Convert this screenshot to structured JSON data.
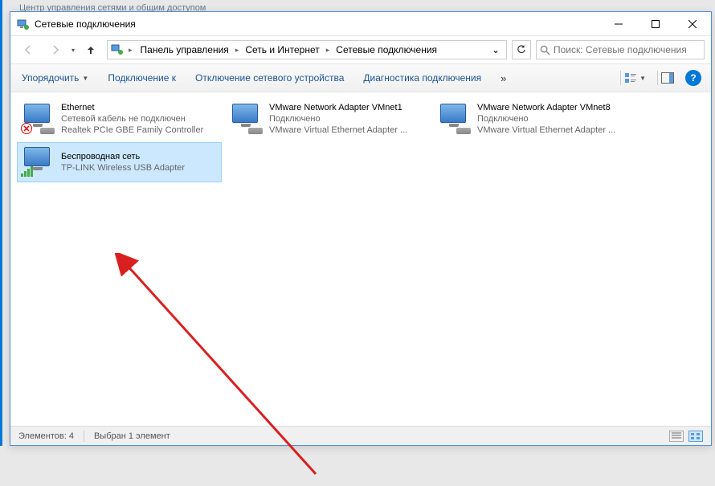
{
  "backgroundWindow": {
    "title": "Центр управления сетями и общим доступом"
  },
  "window": {
    "title": "Сетевые подключения"
  },
  "breadcrumb": {
    "items": [
      "Панель управления",
      "Сеть и Интернет",
      "Сетевые подключения"
    ]
  },
  "search": {
    "placeholder": "Поиск: Сетевые подключения"
  },
  "toolbar": {
    "organize": "Упорядочить",
    "connectTo": "Подключение к",
    "disable": "Отключение сетевого устройства",
    "diagnose": "Диагностика подключения"
  },
  "connections": [
    {
      "name": "Ethernet",
      "status": "Сетевой кабель не подключен",
      "device": "Realtek PCIe GBE Family Controller",
      "statusType": "disconnected",
      "selected": false
    },
    {
      "name": "VMware Network Adapter VMnet1",
      "status": "Подключено",
      "device": "VMware Virtual Ethernet Adapter ...",
      "statusType": "connected",
      "selected": false
    },
    {
      "name": "VMware Network Adapter VMnet8",
      "status": "Подключено",
      "device": "VMware Virtual Ethernet Adapter ...",
      "statusType": "connected",
      "selected": false
    },
    {
      "name": "Беспроводная сеть",
      "status": " ",
      "device": "TP-LINK Wireless USB Adapter",
      "statusType": "wireless",
      "selected": true
    }
  ],
  "statusbar": {
    "count": "Элементов: 4",
    "selected": "Выбран 1 элемент"
  }
}
